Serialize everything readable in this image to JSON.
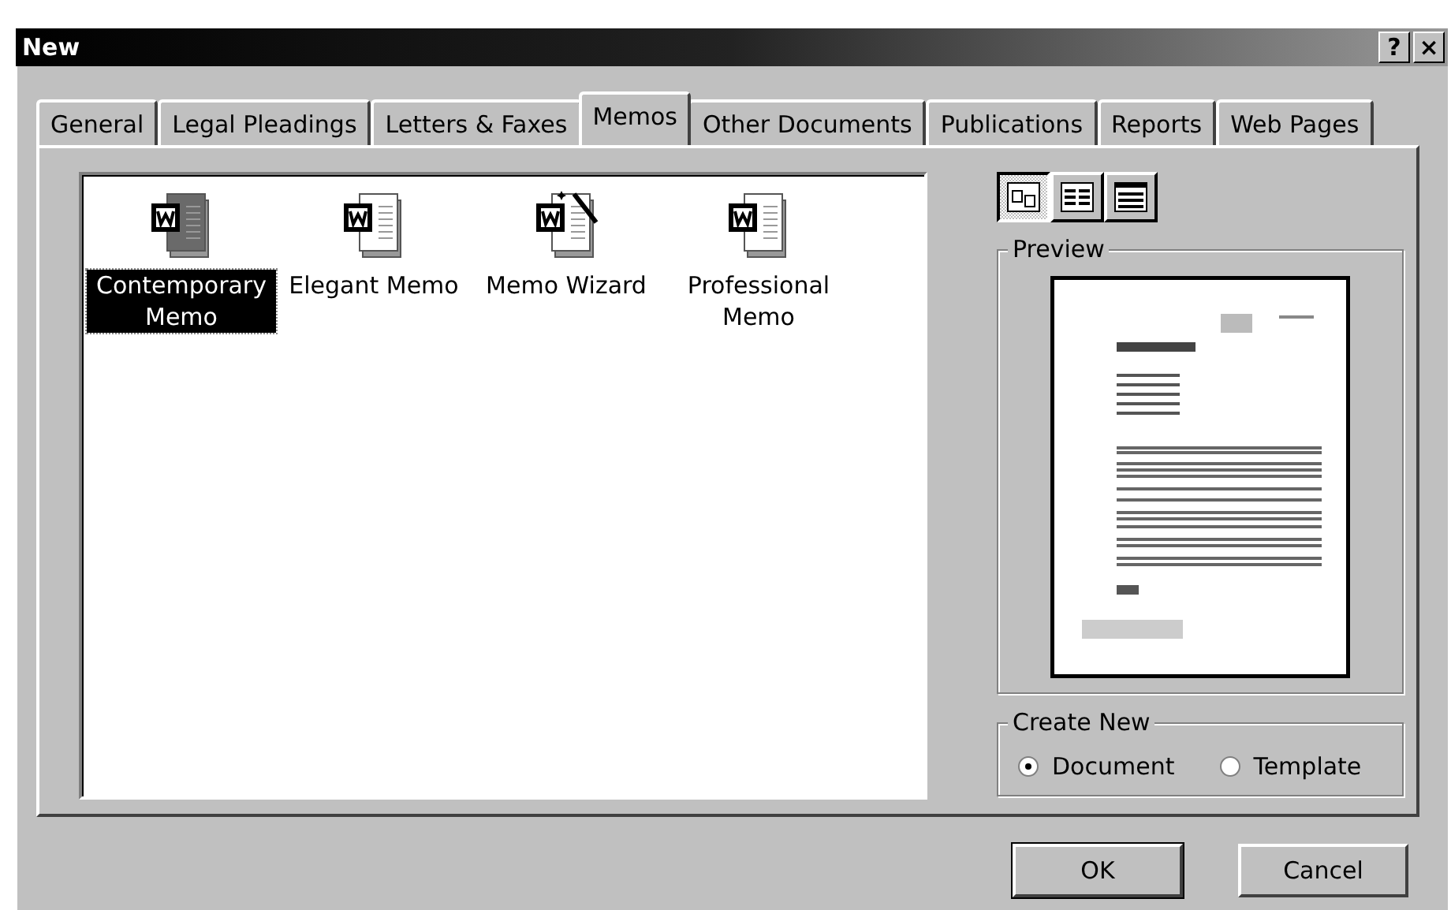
{
  "window": {
    "title": "New",
    "help_button": "?",
    "close_button": "×"
  },
  "tabs": [
    {
      "label": "General",
      "selected": false
    },
    {
      "label": "Legal Pleadings",
      "selected": false
    },
    {
      "label": "Letters & Faxes",
      "selected": false
    },
    {
      "label": "Memos",
      "selected": true
    },
    {
      "label": "Other Documents",
      "selected": false
    },
    {
      "label": "Publications",
      "selected": false
    },
    {
      "label": "Reports",
      "selected": false
    },
    {
      "label": "Web Pages",
      "selected": false
    }
  ],
  "templates": [
    {
      "label": "Contemporary Memo",
      "kind": "dark",
      "selected": true
    },
    {
      "label": "Elegant Memo",
      "kind": "plain",
      "selected": false
    },
    {
      "label": "Memo Wizard",
      "kind": "wizard",
      "selected": false
    },
    {
      "label": "Professional Memo",
      "kind": "plain",
      "selected": false
    }
  ],
  "view_buttons": [
    {
      "kind": "large",
      "selected": true
    },
    {
      "kind": "list",
      "selected": false
    },
    {
      "kind": "details",
      "selected": false
    }
  ],
  "preview": {
    "label": "Preview"
  },
  "create_new": {
    "label": "Create New",
    "options": [
      {
        "label": "Document",
        "selected": true
      },
      {
        "label": "Template",
        "selected": false
      }
    ]
  },
  "buttons": [
    {
      "label": "OK",
      "default": true
    },
    {
      "label": "Cancel",
      "default": false
    }
  ]
}
